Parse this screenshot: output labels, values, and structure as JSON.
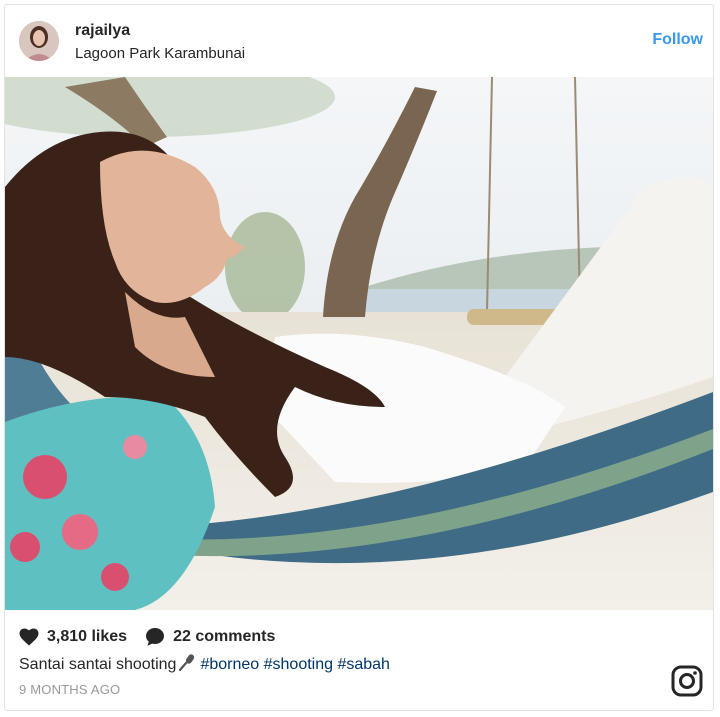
{
  "post": {
    "username": "rajailya",
    "location": "Lagoon Park Karambunai",
    "follow_label": "Follow",
    "likes": "3,810 likes",
    "comments": "22 comments",
    "caption_text": "Santai santai shooting",
    "caption_tags": "#borneo #shooting #sabah",
    "timestamp": "9 MONTHS AGO"
  },
  "colors": {
    "accent": "#3897f0",
    "hashtag": "#003569",
    "muted": "#999999",
    "text": "#262626"
  },
  "icons": {
    "like": "heart-icon",
    "comment": "comment-bubble-icon",
    "caption_emoji": "microphone-icon",
    "brand": "instagram-icon"
  }
}
